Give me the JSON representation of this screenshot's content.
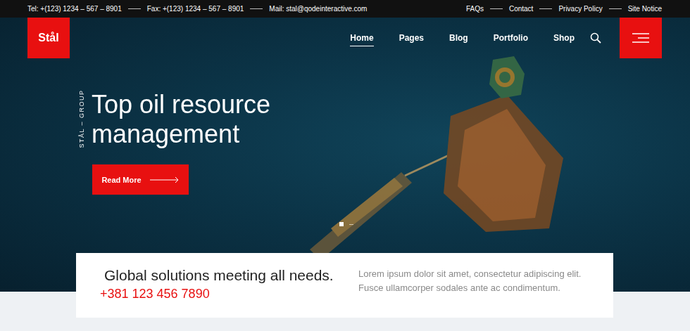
{
  "contact": [
    "Tel: +(123) 1234 – 567 – 8901",
    "Fax: +(123) 1234 – 567 – 8901",
    "Mail: stal@qodeinteractive.com"
  ],
  "top_links": [
    "FAQs",
    "Contact",
    "Privacy Policy",
    "Site Notice"
  ],
  "logo": "Stål",
  "nav": [
    {
      "label": "Home",
      "selected": true
    },
    {
      "label": "Pages",
      "selected": false
    },
    {
      "label": "Blog",
      "selected": false
    },
    {
      "label": "Portfolio",
      "selected": false
    },
    {
      "label": "Shop",
      "selected": false
    }
  ],
  "hero": {
    "tagline": "STÅL – GROUP",
    "title": "Top oil resource management",
    "button": "Read More"
  },
  "slider": [
    {
      "selected": true
    },
    {
      "selected": false
    }
  ],
  "card": {
    "heading": "Global solutions meeting all needs.",
    "phone": "+381 123 456 7890",
    "text": "Lorem ipsum dolor sit amet, consectetur adipiscing elit. Fusce ullamcorper sodales ante ac condimentum."
  }
}
